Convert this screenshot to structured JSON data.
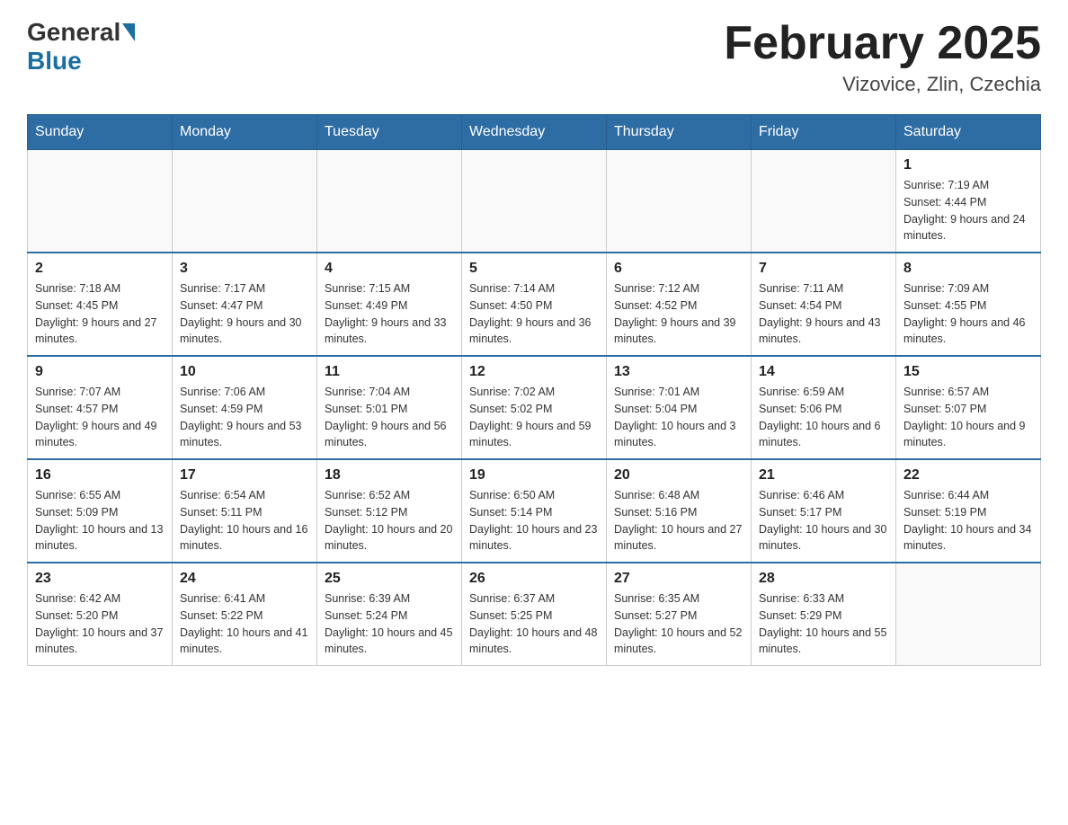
{
  "header": {
    "logo_general": "General",
    "logo_blue": "Blue",
    "title": "February 2025",
    "subtitle": "Vizovice, Zlin, Czechia"
  },
  "days_of_week": [
    "Sunday",
    "Monday",
    "Tuesday",
    "Wednesday",
    "Thursday",
    "Friday",
    "Saturday"
  ],
  "weeks": [
    [
      {
        "day": "",
        "sunrise": "",
        "sunset": "",
        "daylight": ""
      },
      {
        "day": "",
        "sunrise": "",
        "sunset": "",
        "daylight": ""
      },
      {
        "day": "",
        "sunrise": "",
        "sunset": "",
        "daylight": ""
      },
      {
        "day": "",
        "sunrise": "",
        "sunset": "",
        "daylight": ""
      },
      {
        "day": "",
        "sunrise": "",
        "sunset": "",
        "daylight": ""
      },
      {
        "day": "",
        "sunrise": "",
        "sunset": "",
        "daylight": ""
      },
      {
        "day": "1",
        "sunrise": "Sunrise: 7:19 AM",
        "sunset": "Sunset: 4:44 PM",
        "daylight": "Daylight: 9 hours and 24 minutes."
      }
    ],
    [
      {
        "day": "2",
        "sunrise": "Sunrise: 7:18 AM",
        "sunset": "Sunset: 4:45 PM",
        "daylight": "Daylight: 9 hours and 27 minutes."
      },
      {
        "day": "3",
        "sunrise": "Sunrise: 7:17 AM",
        "sunset": "Sunset: 4:47 PM",
        "daylight": "Daylight: 9 hours and 30 minutes."
      },
      {
        "day": "4",
        "sunrise": "Sunrise: 7:15 AM",
        "sunset": "Sunset: 4:49 PM",
        "daylight": "Daylight: 9 hours and 33 minutes."
      },
      {
        "day": "5",
        "sunrise": "Sunrise: 7:14 AM",
        "sunset": "Sunset: 4:50 PM",
        "daylight": "Daylight: 9 hours and 36 minutes."
      },
      {
        "day": "6",
        "sunrise": "Sunrise: 7:12 AM",
        "sunset": "Sunset: 4:52 PM",
        "daylight": "Daylight: 9 hours and 39 minutes."
      },
      {
        "day": "7",
        "sunrise": "Sunrise: 7:11 AM",
        "sunset": "Sunset: 4:54 PM",
        "daylight": "Daylight: 9 hours and 43 minutes."
      },
      {
        "day": "8",
        "sunrise": "Sunrise: 7:09 AM",
        "sunset": "Sunset: 4:55 PM",
        "daylight": "Daylight: 9 hours and 46 minutes."
      }
    ],
    [
      {
        "day": "9",
        "sunrise": "Sunrise: 7:07 AM",
        "sunset": "Sunset: 4:57 PM",
        "daylight": "Daylight: 9 hours and 49 minutes."
      },
      {
        "day": "10",
        "sunrise": "Sunrise: 7:06 AM",
        "sunset": "Sunset: 4:59 PM",
        "daylight": "Daylight: 9 hours and 53 minutes."
      },
      {
        "day": "11",
        "sunrise": "Sunrise: 7:04 AM",
        "sunset": "Sunset: 5:01 PM",
        "daylight": "Daylight: 9 hours and 56 minutes."
      },
      {
        "day": "12",
        "sunrise": "Sunrise: 7:02 AM",
        "sunset": "Sunset: 5:02 PM",
        "daylight": "Daylight: 9 hours and 59 minutes."
      },
      {
        "day": "13",
        "sunrise": "Sunrise: 7:01 AM",
        "sunset": "Sunset: 5:04 PM",
        "daylight": "Daylight: 10 hours and 3 minutes."
      },
      {
        "day": "14",
        "sunrise": "Sunrise: 6:59 AM",
        "sunset": "Sunset: 5:06 PM",
        "daylight": "Daylight: 10 hours and 6 minutes."
      },
      {
        "day": "15",
        "sunrise": "Sunrise: 6:57 AM",
        "sunset": "Sunset: 5:07 PM",
        "daylight": "Daylight: 10 hours and 9 minutes."
      }
    ],
    [
      {
        "day": "16",
        "sunrise": "Sunrise: 6:55 AM",
        "sunset": "Sunset: 5:09 PM",
        "daylight": "Daylight: 10 hours and 13 minutes."
      },
      {
        "day": "17",
        "sunrise": "Sunrise: 6:54 AM",
        "sunset": "Sunset: 5:11 PM",
        "daylight": "Daylight: 10 hours and 16 minutes."
      },
      {
        "day": "18",
        "sunrise": "Sunrise: 6:52 AM",
        "sunset": "Sunset: 5:12 PM",
        "daylight": "Daylight: 10 hours and 20 minutes."
      },
      {
        "day": "19",
        "sunrise": "Sunrise: 6:50 AM",
        "sunset": "Sunset: 5:14 PM",
        "daylight": "Daylight: 10 hours and 23 minutes."
      },
      {
        "day": "20",
        "sunrise": "Sunrise: 6:48 AM",
        "sunset": "Sunset: 5:16 PM",
        "daylight": "Daylight: 10 hours and 27 minutes."
      },
      {
        "day": "21",
        "sunrise": "Sunrise: 6:46 AM",
        "sunset": "Sunset: 5:17 PM",
        "daylight": "Daylight: 10 hours and 30 minutes."
      },
      {
        "day": "22",
        "sunrise": "Sunrise: 6:44 AM",
        "sunset": "Sunset: 5:19 PM",
        "daylight": "Daylight: 10 hours and 34 minutes."
      }
    ],
    [
      {
        "day": "23",
        "sunrise": "Sunrise: 6:42 AM",
        "sunset": "Sunset: 5:20 PM",
        "daylight": "Daylight: 10 hours and 37 minutes."
      },
      {
        "day": "24",
        "sunrise": "Sunrise: 6:41 AM",
        "sunset": "Sunset: 5:22 PM",
        "daylight": "Daylight: 10 hours and 41 minutes."
      },
      {
        "day": "25",
        "sunrise": "Sunrise: 6:39 AM",
        "sunset": "Sunset: 5:24 PM",
        "daylight": "Daylight: 10 hours and 45 minutes."
      },
      {
        "day": "26",
        "sunrise": "Sunrise: 6:37 AM",
        "sunset": "Sunset: 5:25 PM",
        "daylight": "Daylight: 10 hours and 48 minutes."
      },
      {
        "day": "27",
        "sunrise": "Sunrise: 6:35 AM",
        "sunset": "Sunset: 5:27 PM",
        "daylight": "Daylight: 10 hours and 52 minutes."
      },
      {
        "day": "28",
        "sunrise": "Sunrise: 6:33 AM",
        "sunset": "Sunset: 5:29 PM",
        "daylight": "Daylight: 10 hours and 55 minutes."
      },
      {
        "day": "",
        "sunrise": "",
        "sunset": "",
        "daylight": ""
      }
    ]
  ]
}
